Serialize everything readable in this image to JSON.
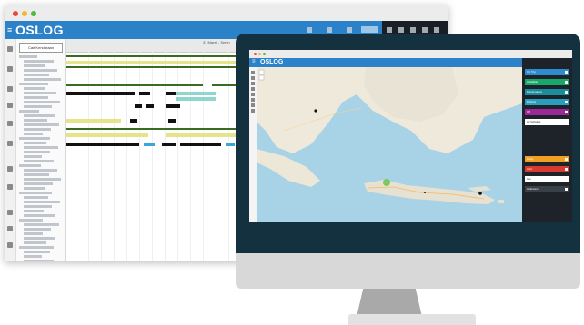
{
  "back_window": {
    "title_dots": [
      "#e8483b",
      "#f6b431",
      "#4fba3c"
    ],
    "logo": "OSLOG",
    "search_button": "Cari Kendaraan",
    "timeline_header": "31 Maret - Senin"
  },
  "monitor": {
    "logo": "OSLOG",
    "title_dots": [
      "#e8483b",
      "#f6b431",
      "#4fba3c"
    ],
    "panel_buttons": [
      {
        "label": "On Trip",
        "color": "#2e8bd0"
      },
      {
        "label": "Available",
        "color": "#1aa76a"
      },
      {
        "label": "Maintenance",
        "color": "#1b8e9d"
      },
      {
        "label": "Parking",
        "color": "#2a9fbd"
      },
      {
        "label": "Off",
        "color": "#9b2a98"
      },
      {
        "label": "All Vehicles",
        "color": "#ffffff"
      }
    ],
    "panel_buttons_2": [
      {
        "label": "Delay",
        "color": "#f0a023"
      },
      {
        "label": "Alert",
        "color": "#d93a2f"
      },
      {
        "label": "Idle",
        "color": "#ffffff"
      },
      {
        "label": "Unknown",
        "color": "#3a4048"
      }
    ]
  },
  "colors": {
    "brand_blue": "#2b82c9",
    "monitor_frame": "#14313f",
    "bar_black": "#111111",
    "bar_yellow": "#e6e48a",
    "bar_teal": "#8fd6cc",
    "bar_olive": "#3a6b22"
  }
}
